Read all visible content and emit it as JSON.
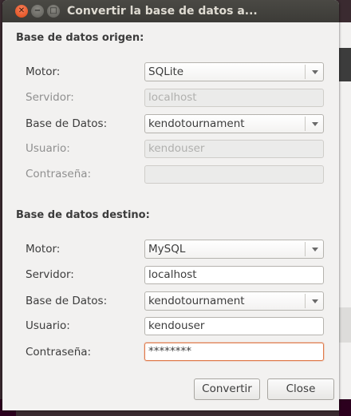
{
  "window": {
    "title": "Convertir la base de datos a...",
    "controls": [
      "close",
      "minimize",
      "maximize"
    ]
  },
  "origin": {
    "heading": "Base de datos origen:",
    "motor": {
      "label": "Motor:",
      "value": "SQLite"
    },
    "servidor": {
      "label": "Servidor:",
      "value": "localhost"
    },
    "base_datos": {
      "label": "Base de Datos:",
      "value": "kendotournament"
    },
    "usuario": {
      "label": "Usuario:",
      "value": "kendouser"
    },
    "contrasena": {
      "label": "Contraseña:",
      "value": ""
    }
  },
  "destination": {
    "heading": "Base de datos destino:",
    "motor": {
      "label": "Motor:",
      "value": "MySQL"
    },
    "servidor": {
      "label": "Servidor:",
      "value": "localhost"
    },
    "base_datos": {
      "label": "Base de Datos:",
      "value": "kendotournament"
    },
    "usuario": {
      "label": "Usuario:",
      "value": "kendouser"
    },
    "contrasena": {
      "label": "Contraseña:",
      "value": "********"
    }
  },
  "buttons": {
    "convert": "Convertir",
    "close": "Close"
  }
}
